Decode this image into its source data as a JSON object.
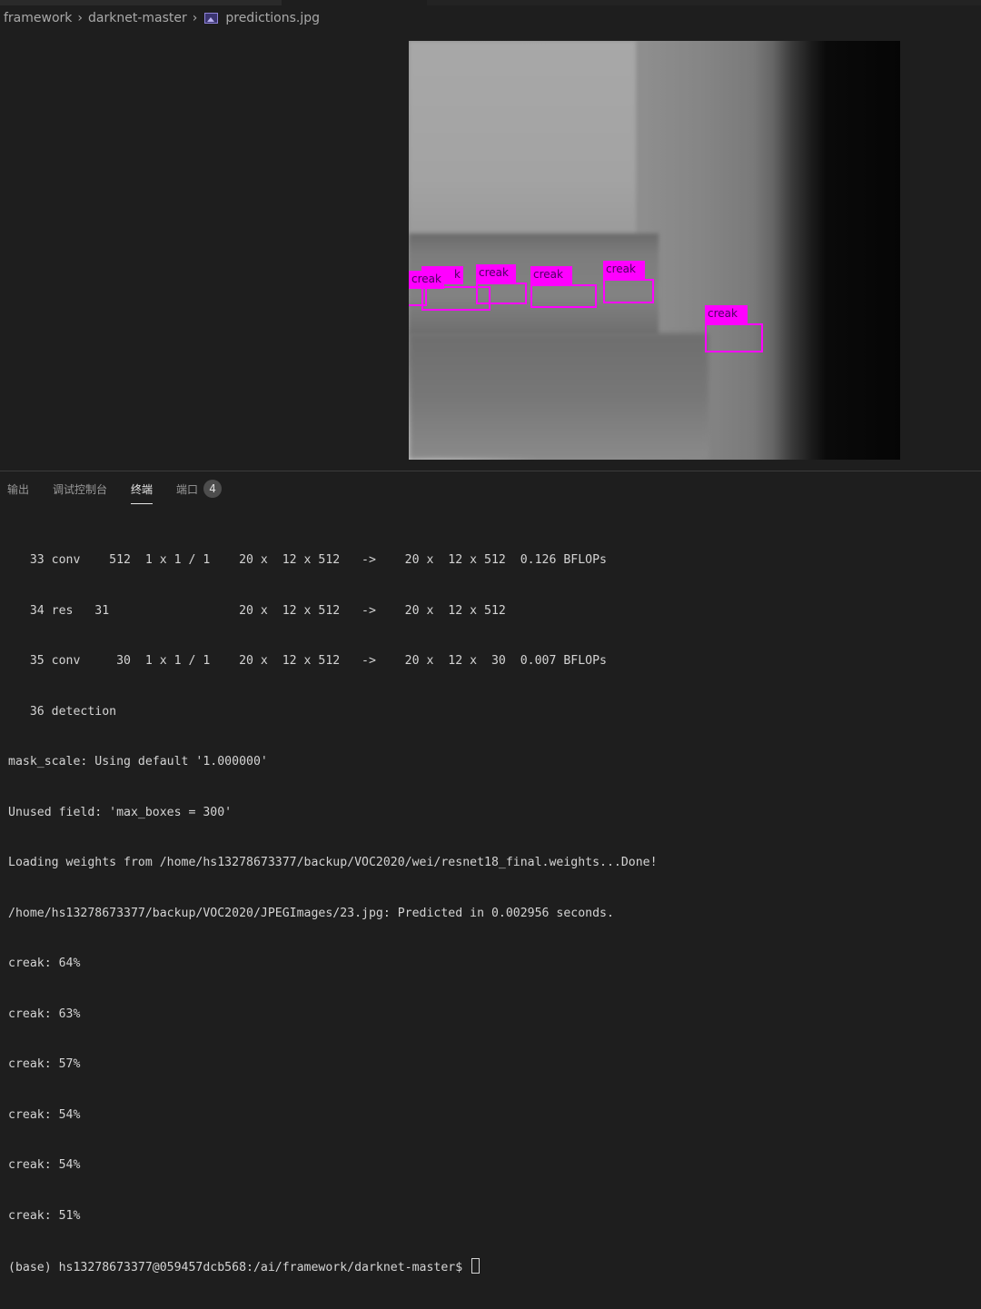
{
  "breadcrumb": {
    "items": [
      "framework",
      "darknet-master",
      "predictions.jpg"
    ],
    "file_icon": "image-file-icon"
  },
  "image_view": {
    "file": "predictions.jpg",
    "detection_color": "#ff00ff",
    "detections": [
      {
        "label": "creak",
        "note": "leftmost, partially overlapped"
      },
      {
        "label": "creak",
        "note": "overlapped label, visible as 'k'"
      },
      {
        "label": "creak"
      },
      {
        "label": "creak"
      },
      {
        "label": "creak"
      },
      {
        "label": "creak"
      }
    ]
  },
  "panel": {
    "tabs": [
      {
        "label": "输出",
        "active": false
      },
      {
        "label": "调试控制台",
        "active": false
      },
      {
        "label": "终端",
        "active": true
      },
      {
        "label": "端口",
        "active": false,
        "badge": "4"
      }
    ]
  },
  "terminal": {
    "lines": [
      "   33 conv    512  1 x 1 / 1    20 x  12 x 512   ->    20 x  12 x 512  0.126 BFLOPs",
      "   34 res   31                  20 x  12 x 512   ->    20 x  12 x 512",
      "   35 conv     30  1 x 1 / 1    20 x  12 x 512   ->    20 x  12 x  30  0.007 BFLOPs",
      "   36 detection",
      "mask_scale: Using default '1.000000'",
      "Unused field: 'max_boxes = 300'",
      "Loading weights from /home/hs13278673377/backup/VOC2020/wei/resnet18_final.weights...Done!",
      "/home/hs13278673377/backup/VOC2020/JPEGImages/23.jpg: Predicted in 0.002956 seconds.",
      "creak: 64%",
      "creak: 63%",
      "creak: 57%",
      "creak: 54%",
      "creak: 54%",
      "creak: 51%"
    ],
    "prompt": "(base) hs13278673377@059457dcb568:/ai/framework/darknet-master$ "
  }
}
